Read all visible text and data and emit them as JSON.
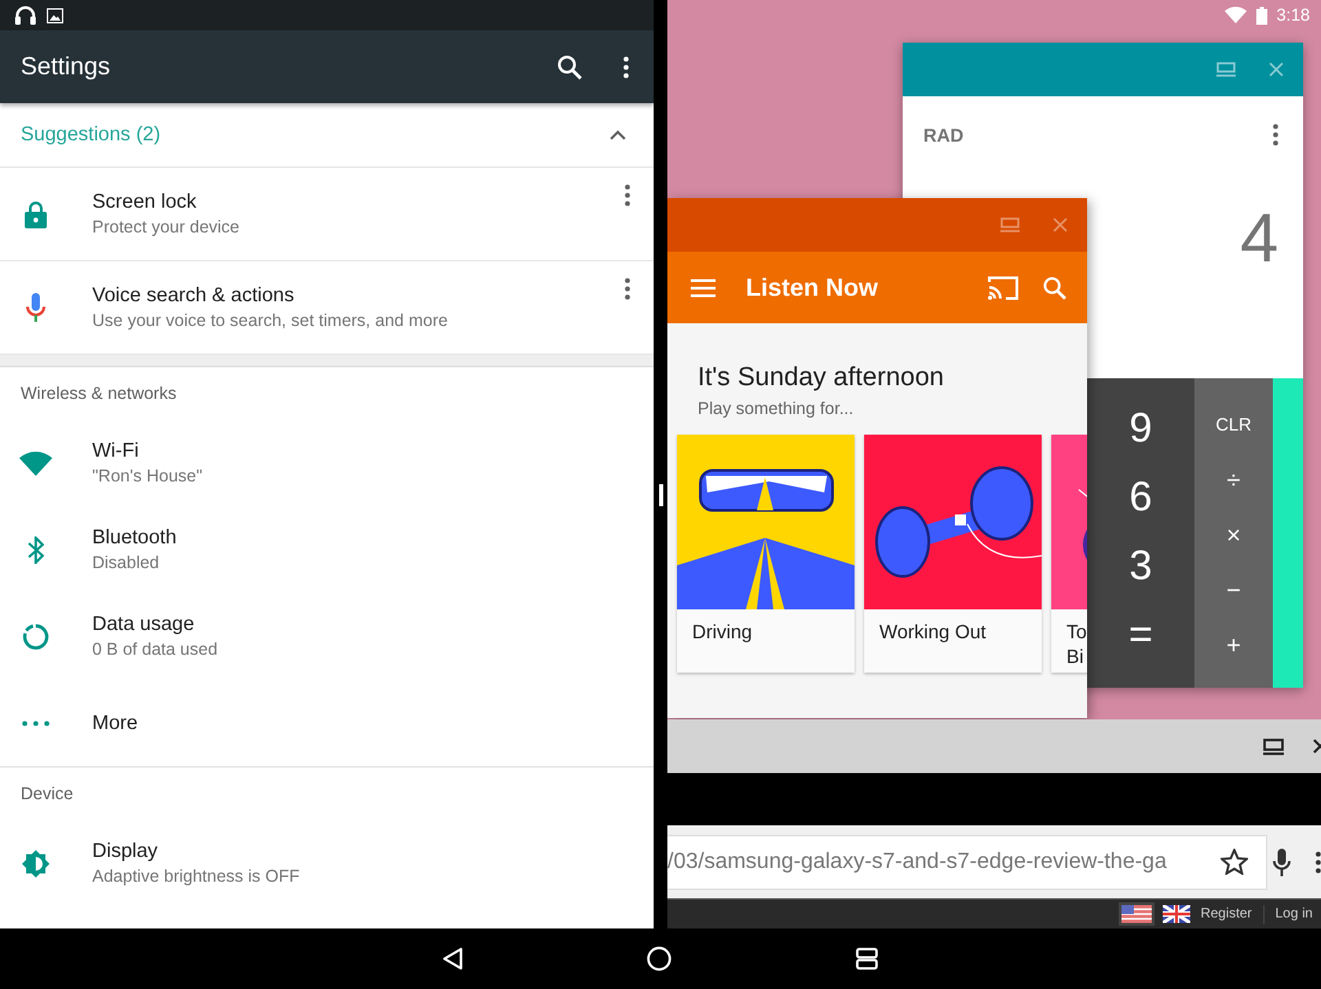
{
  "status_bar": {
    "time": "3:18"
  },
  "settings": {
    "title": "Settings",
    "suggestions": {
      "label": "Suggestions (2)",
      "expanded": true,
      "items": [
        {
          "kind": "lock",
          "title": "Screen lock",
          "summary": "Protect your device"
        },
        {
          "kind": "mic",
          "title": "Voice search & actions",
          "summary": "Use your voice to search, set timers, and more"
        }
      ]
    },
    "sections": [
      {
        "header": "Wireless & networks",
        "items": [
          {
            "kind": "wifi",
            "title": "Wi-Fi",
            "summary": "\"Ron's House\""
          },
          {
            "kind": "bluetooth",
            "title": "Bluetooth",
            "summary": "Disabled"
          },
          {
            "kind": "data",
            "title": "Data usage",
            "summary": "0 B of data used"
          },
          {
            "kind": "more",
            "title": "More"
          }
        ]
      },
      {
        "header": "Device",
        "items": [
          {
            "kind": "display",
            "title": "Display",
            "summary": "Adaptive brightness is OFF"
          }
        ]
      }
    ]
  },
  "calculator": {
    "mode": "RAD",
    "display": "4",
    "digits": [
      "9",
      "6",
      "3",
      "="
    ],
    "operators": [
      "CLR",
      "÷",
      "×",
      "−",
      "+"
    ]
  },
  "music": {
    "title": "Listen Now",
    "heading": "It's Sunday afternoon",
    "subtitle": "Play something for...",
    "cards": [
      {
        "kind": "driving",
        "lines": [
          "Driving"
        ]
      },
      {
        "kind": "workout",
        "lines": [
          "Working Out"
        ]
      },
      {
        "kind": "party",
        "lines": [
          "To",
          "Bi"
        ]
      }
    ]
  },
  "browser": {
    "url": "/03/samsung-galaxy-s7-and-s7-edge-review-the-ga",
    "links": [
      "Register",
      "Log in"
    ]
  }
}
